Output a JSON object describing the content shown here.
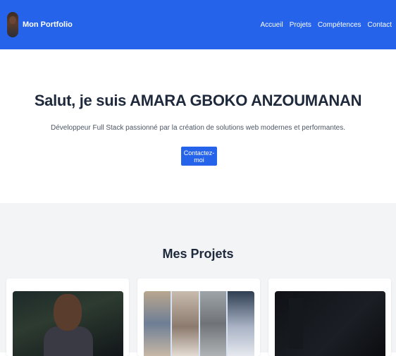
{
  "navbar": {
    "brand": "Mon Portfolio",
    "links": [
      "Accueil",
      "Projets",
      "Compétences",
      "Contact"
    ],
    "background": "#2563eb"
  },
  "hero": {
    "title": "Salut, je suis AMARA GBOKO ANZOUMANAN",
    "subtitle": "Développeur Full Stack passionné par la création de solutions web modernes et performantes.",
    "cta_label": "Contactez-moi"
  },
  "projects": {
    "heading": "Mes Projets",
    "cards": [
      {
        "thumb": "photo-portrait"
      },
      {
        "thumb": "photo-collage"
      },
      {
        "thumb": "dark-screen"
      }
    ]
  },
  "colors": {
    "accent": "#2563eb",
    "section_bg": "#f3f4f6",
    "heading": "#1e293b"
  }
}
